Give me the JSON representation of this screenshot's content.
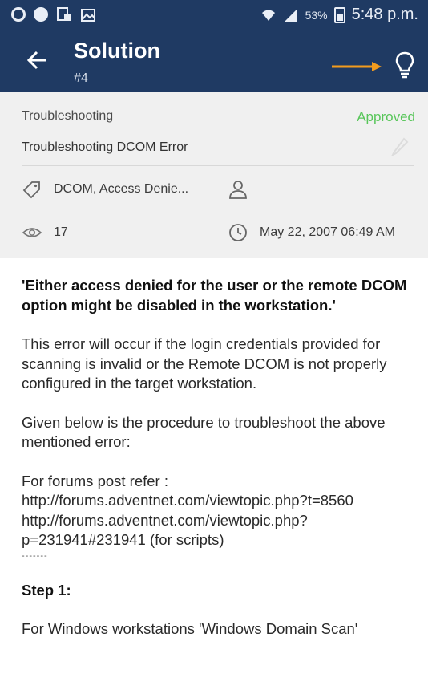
{
  "status_bar": {
    "battery_percent": "53%",
    "time": "5:48 p.m."
  },
  "app_bar": {
    "title": "Solution",
    "subtitle": "#4"
  },
  "meta": {
    "category": "Troubleshooting",
    "status": "Approved",
    "subject": "Troubleshooting DCOM Error",
    "tags": "DCOM,  Access Denie...",
    "views": "17",
    "date": "May 22, 2007 06:49 AM"
  },
  "content": {
    "heading": "'Either access denied for the user or the remote DCOM option might be disabled in the workstation.'",
    "para1": "This error will occur if the login credentials provided for scanning is invalid or the Remote DCOM is not properly configured in the target workstation.",
    "para2": "Given below is the procedure to troubleshoot the above mentioned error:",
    "forum_label": "For forums post refer :",
    "link1": "http://forums.adventnet.com/viewtopic.php?t=8560",
    "link2": "http://forums.adventnet.com/viewtopic.php?p=231941#231941 (for scripts)",
    "separator": "-------",
    "step_title": "Step 1:",
    "step_text": "For Windows workstations 'Windows Domain Scan'"
  },
  "colors": {
    "app_bar": "#1f3a63",
    "approved": "#58c65a",
    "arrow": "#f39c1e",
    "meta_bg": "#f0f0f0"
  }
}
